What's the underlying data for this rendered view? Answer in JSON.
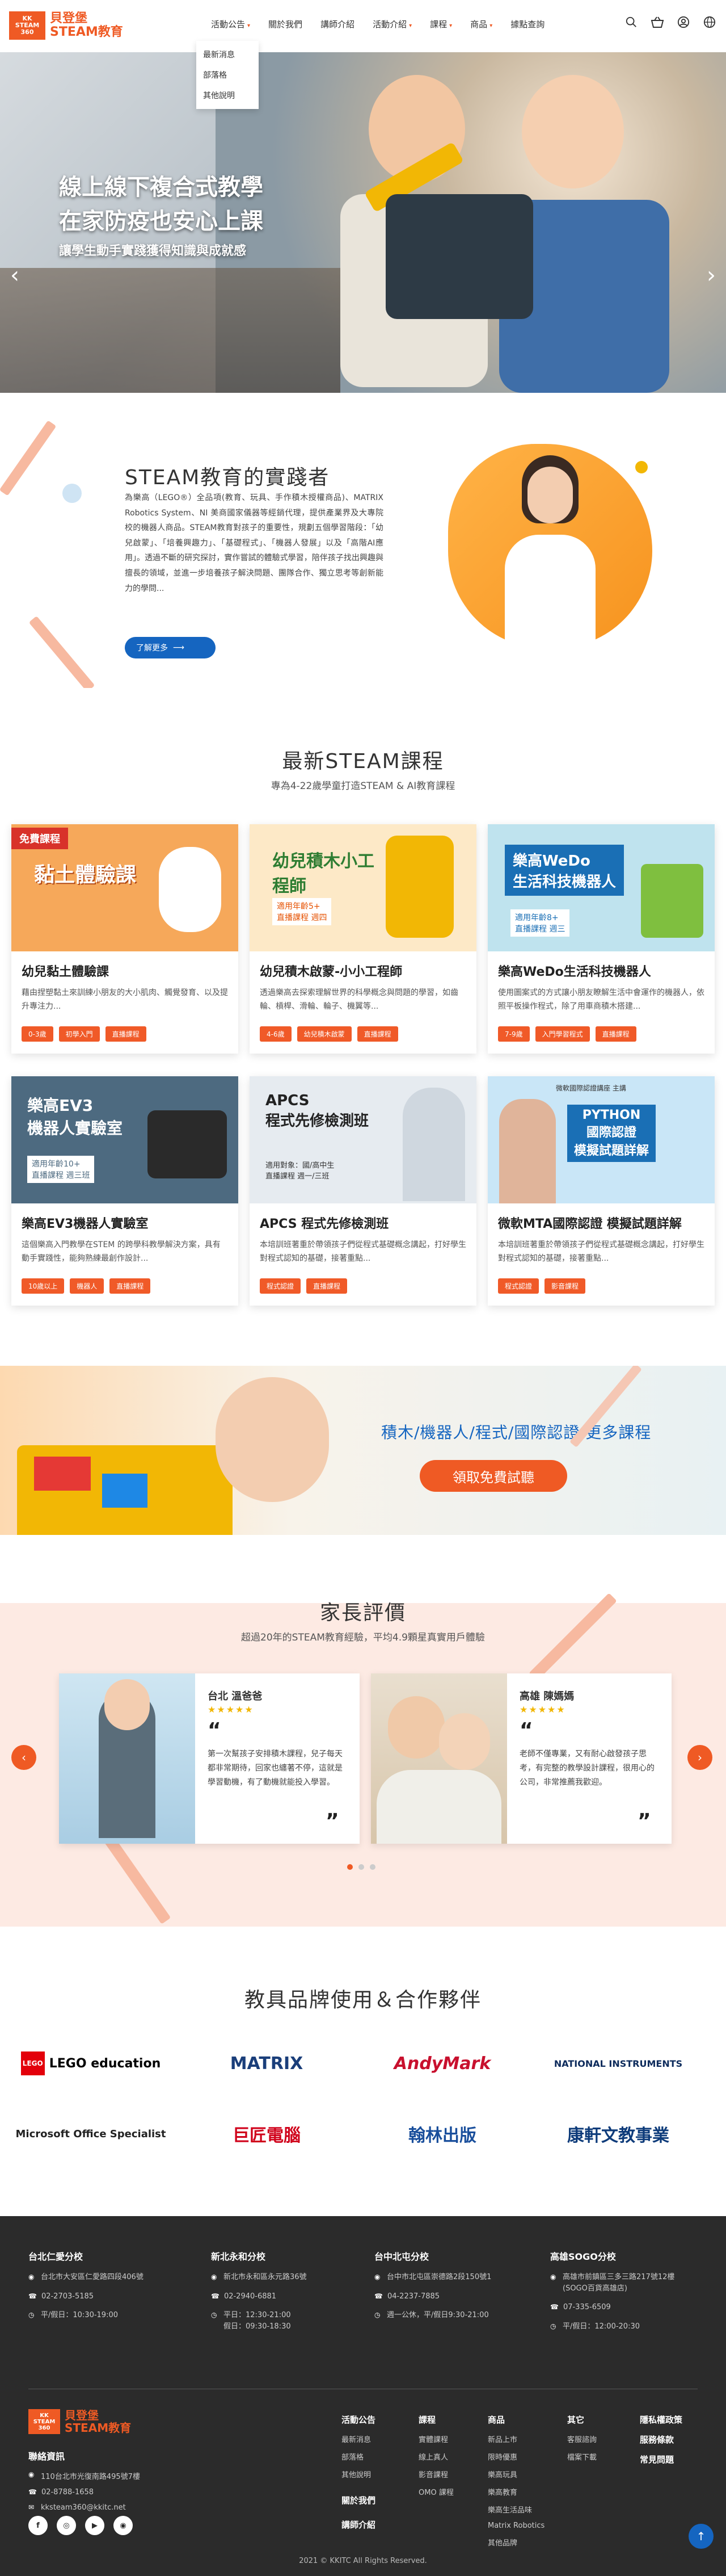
{
  "header": {
    "logo_badge": "KK\nSTEAM\n360",
    "logo_line1": "貝登堡",
    "logo_line2": "STEAM教育",
    "nav": [
      {
        "label": "活動公告",
        "has_dropdown": true
      },
      {
        "label": "關於我們",
        "has_dropdown": false
      },
      {
        "label": "講師介紹",
        "has_dropdown": false
      },
      {
        "label": "活動介紹",
        "has_dropdown": true
      },
      {
        "label": "課程",
        "has_dropdown": true
      },
      {
        "label": "商品",
        "has_dropdown": true
      },
      {
        "label": "據點查詢",
        "has_dropdown": false
      }
    ],
    "dropdown": [
      "最新消息",
      "部落格",
      "其他說明"
    ],
    "caret": "▾",
    "icons": [
      "search-icon",
      "basket-icon",
      "user-icon",
      "globe-icon"
    ]
  },
  "hero": {
    "title_line1": "線上線下複合式教學",
    "title_line2": "在家防疫也安心上課",
    "subtitle": "讓學生動手實踐獲得知識與成就感",
    "prev": "‹",
    "next": "›"
  },
  "about": {
    "title": "STEAM教育的實踐者",
    "text": "為樂高（LEGO®）全品項(教育、玩具、手作積木授權商品)、MATRIX Robotics System、NI 美商國家儀器等經銷代理，提供產業界及大專院校的機器人商品。STEAM教育對孩子的重要性，規劃五個學習階段：「幼兒啟蒙」、「培養興趣力」、「基礎程式」、「機器人發展」以及「高階AI應用」。透過不斷的研究探討，實作嘗試的體驗式學習，陪伴孩子找出興趣與擅長的領域，並進一步培養孩子解決問題、團隊合作、獨立思考等創新能力的學問...",
    "button": "了解更多",
    "button_arrow": "⟶"
  },
  "courses": {
    "title": "最新STEAM課程",
    "subtitle": "專為4-22歲學童打造STEAM & AI教育課程",
    "cards": [
      {
        "img_label": "黏土體驗課",
        "img_badge": "免費課程",
        "title": "幼兒黏土體驗課",
        "desc": "藉由捏塑黏土來訓練小朋友的大小肌肉、觸覺發育、以及提升專注力...",
        "tags": [
          "0-3歲",
          "初學入門",
          "直播課程"
        ],
        "bg": "#f6a85a"
      },
      {
        "img_label": "幼兒積木小工程師",
        "img_badge": "適用年齡5+\n直播課程 週四",
        "title": "幼兒積木啟蒙-小小工程師",
        "desc": "透過樂高去探索理解世界的科學概念與問題的學習，如齒輪、槓桿、滑輪、輪子、機翼等...",
        "tags": [
          "4-6歲",
          "幼兒積木啟蒙",
          "直播課程"
        ],
        "bg": "#fde9c7"
      },
      {
        "img_label": "樂高WeDo\n生活科技機器人",
        "img_badge": "適用年齡8+\n直播課程 週三",
        "title": "樂高WeDo生活科技機器人",
        "desc": "使用圖案式的方式讓小朋友瞭解生活中會運作的機器人，依照平板操作程式，除了用車商積木搭建...",
        "tags": [
          "7-9歲",
          "入門學習程式",
          "直播課程"
        ],
        "bg": "#bfe3ee"
      },
      {
        "img_label": "樂高EV3\n機器人實驗室",
        "img_badge": "適用年齡10+\n直播課程 週三班",
        "title": "樂高EV3機器人實驗室",
        "desc": "這個樂高入門教學在STEM 的跨學科教學解決方案，具有動手實踐性，能夠熟練最創作設計...",
        "tags": [
          "10歲以上",
          "機器人",
          "直播課程"
        ],
        "bg": "#4d6a80"
      },
      {
        "img_label": "APCS\n程式先修檢測班",
        "img_badge": "適用對象：國/高中生\n直播課程 週一/三班",
        "title": "APCS 程式先修檢測班",
        "desc": "本培訓班著重於帶領孩子們從程式基礎概念講起，打好學生對程式認知的基礎，接著重點...",
        "tags": [
          "程式認證",
          "直播課程"
        ],
        "bg": "#e6ebf0"
      },
      {
        "img_label": "PYTHON\n國際認證\n模擬試題詳解",
        "img_badge": "微軟國際認證講座 主講",
        "title": "微軟MTA國際認證 模擬試題詳解",
        "desc": "本培訓班著重於帶領孩子們從程式基礎概念講起，打好學生對程式認知的基礎，接著重點...",
        "tags": [
          "程式認證",
          "影音課程"
        ],
        "bg": "#c9e6f7"
      }
    ]
  },
  "promo": {
    "text": "積木/機器人/程式/國際認證 更多課程",
    "button": "領取免費試聽"
  },
  "reviews": {
    "title": "家長評價",
    "subtitle": "超過20年的STEAM教育經驗，平均4.9顆星真實用戶體驗",
    "stars": "★★★★★",
    "items": [
      {
        "name": "台北 溫爸爸",
        "text": "第一次幫孩子安排積木課程，兒子每天都非常期待，回家也纏著不停，這就是學習動機，有了動機就能投入學習。"
      },
      {
        "name": "高雄 陳媽媽",
        "text": "老師不僅專業，又有耐心啟發孩子思考，有完整的教學設計課程，很用心的公司，非常推薦我歡迎。"
      }
    ],
    "open_quote": "“",
    "close_quote": "”",
    "prev": "‹",
    "next": "›"
  },
  "partners": {
    "title": "教具品牌使用＆合作夥伴",
    "logos": [
      {
        "label": "LEGO education",
        "color": "#000"
      },
      {
        "label": "MATRIX",
        "color": "#1a3e7a"
      },
      {
        "label": "AndyMark",
        "color": "#c8102e"
      },
      {
        "label": "NATIONAL INSTRUMENTS",
        "color": "#0d2b5c"
      },
      {
        "label": "Microsoft Office Specialist",
        "color": "#222"
      },
      {
        "label": "巨匠電腦",
        "color": "#d0021b"
      },
      {
        "label": "翰林出版",
        "color": "#1a4f9c"
      },
      {
        "label": "康軒文教事業",
        "color": "#0d3b7a"
      }
    ]
  },
  "footer": {
    "branches": [
      {
        "name": "台北仁愛分校",
        "address": "台北市大安區仁愛路四段406號",
        "phone": "02-2703-5185",
        "hours": "平/假日：10:30-19:00"
      },
      {
        "name": "新北永和分校",
        "address": "新北市永和區永元路36號",
        "phone": "02-2940-6881",
        "hours": "平日：12:30-21:00\n假日：09:30-18:30"
      },
      {
        "name": "台中北屯分校",
        "address": "台中市北屯區崇德路2段150號1",
        "phone": "04-2237-7885",
        "hours": "週一公休，平/假日9:30-21:00"
      },
      {
        "name": "高雄SOGO分校",
        "address": "高雄市前鎮區三多三路217號12樓\n(SOGO百貨高雄店)",
        "phone": "07-335-6509",
        "hours": "平/假日：12:00-20:30"
      }
    ],
    "logo_badge": "KK\nSTEAM\n360",
    "logo_line1": "貝登堡",
    "logo_line2": "STEAM教育",
    "contact_title": "聯絡資訊",
    "contact_address": "110台北市光復南路495號7樓",
    "contact_phone": "02-8788-1658",
    "contact_email": "kksteam360@kkitc.net",
    "social": [
      "f",
      "◎",
      "▶",
      "◉"
    ],
    "columns": [
      {
        "title": "活動公告",
        "items": [
          "最新消息",
          "部落格",
          "其他說明"
        ]
      },
      {
        "title": "課程",
        "items": [
          "實體課程",
          "線上真人",
          "影音課程",
          "OMO 課程"
        ]
      },
      {
        "title": "商品",
        "items": [
          "新品上市",
          "限時優惠",
          "樂高玩具",
          "樂高教育",
          "樂高生活品味",
          "Matrix Robotics",
          "其他品牌"
        ]
      },
      {
        "title": "其它",
        "items": [
          "客服諮詢",
          "檔案下載"
        ]
      },
      {
        "title": "隱私權政策",
        "items": [
          "服務條款",
          "常見問題"
        ]
      }
    ],
    "col_extra": [
      "關於我們",
      "講師介紹"
    ],
    "totop": "↑",
    "copyright": "2021 © KKITC All Rights Reserved."
  },
  "colors": {
    "accent": "#ef5a24",
    "primary_blue": "#1565c0",
    "review_bg": "#fdeae3",
    "footer_bg": "#2b2b2b"
  }
}
